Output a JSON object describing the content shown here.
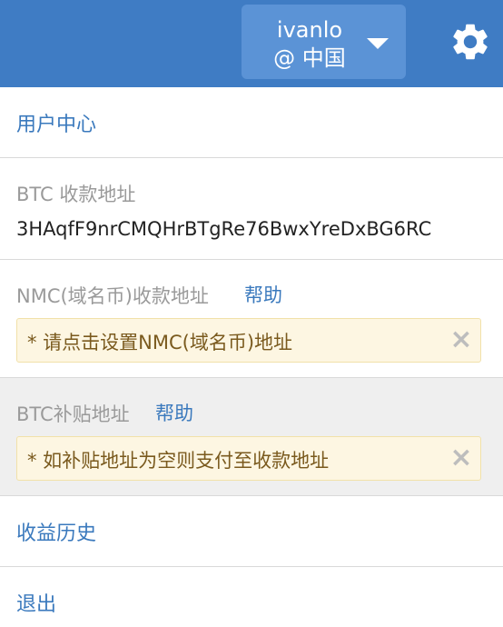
{
  "header": {
    "username": "ivanlo",
    "region": "@ 中国",
    "settings_icon": "gear-icon",
    "dropdown_icon": "caret-down-icon"
  },
  "menu": {
    "user_center": "用户中心",
    "btc_address_label": "BTC 收款地址",
    "btc_address_value": "3HAqfF9nrCMQHrBTgRe76BwxYreDxBG6RC",
    "nmc_label": "NMC(域名币)收款地址",
    "nmc_help": "帮助",
    "nmc_warning": "* 请点击设置NMC(域名币)地址",
    "btc_subsidy_label": "BTC补贴地址",
    "btc_subsidy_help": "帮助",
    "btc_subsidy_warning": "* 如补贴地址为空则支付至收款地址",
    "earnings_history": "收益历史",
    "logout": "退出",
    "close_glyph": "×"
  },
  "colors": {
    "header_bg": "#3f7cc4",
    "user_button_bg": "#5b93d6",
    "link": "#3a79bd",
    "warning_bg": "#fdf6e2",
    "warning_text": "#7a5a1e"
  }
}
